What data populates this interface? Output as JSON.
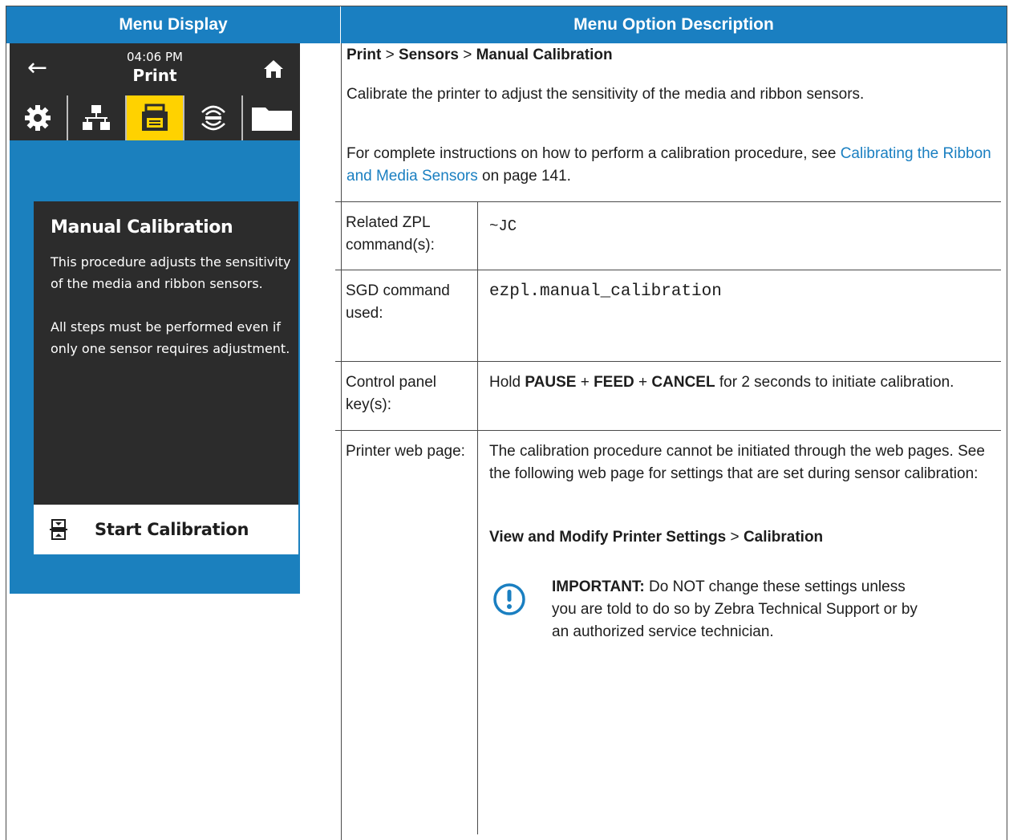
{
  "headers": {
    "left": "Menu Display",
    "right": "Menu Option Description"
  },
  "screen": {
    "time": "04:06 PM",
    "title": "Print",
    "tabs": [
      "settings-icon",
      "network-icon",
      "print-icon",
      "rfid-icon",
      "storage-icon"
    ],
    "active_tab": "print-icon",
    "card_title": "Manual Calibration",
    "card_text_1": "This procedure adjusts the sensitivity of the media and ribbon sensors.",
    "card_text_2": "All steps must be performed even if only one sensor requires adjustment.",
    "button_label": "Start Calibration",
    "colors": {
      "accent": "#1b80be",
      "dark": "#2c2c2c",
      "active": "#ffd200"
    }
  },
  "description": {
    "path": [
      "Print",
      "Sensors",
      "Manual Calibration"
    ],
    "separator": ">",
    "intro": "Calibrate the printer to adjust the sensitivity of the media and ribbon sensors.",
    "instructions_prefix": "For complete instructions on how to perform a calibration procedure, see ",
    "instructions_link": "Calibrating the Ribbon and Media Sensors",
    "instructions_suffix": " on page 141."
  },
  "rows": [
    {
      "label": "Related ZPL command(s):",
      "value": "~JC"
    },
    {
      "label": "SGD command used:",
      "value": "ezpl.manual_calibration"
    },
    {
      "label": "Control panel key(s):",
      "value_parts": [
        "Hold ",
        "PAUSE",
        " + ",
        "FEED",
        " + ",
        "CANCEL",
        " for 2 seconds to initiate calibration."
      ]
    },
    {
      "label": "Printer web page:",
      "value": "The calibration procedure cannot be initiated through the web pages. See the following web page for settings that are set during sensor calibration:"
    }
  ],
  "web_path": [
    "View and Modify Printer Settings",
    "Calibration"
  ],
  "important": {
    "label": "IMPORTANT:",
    "text": " Do NOT change these settings unless you are told to do so by Zebra Technical Support or by an authorized service technician."
  }
}
